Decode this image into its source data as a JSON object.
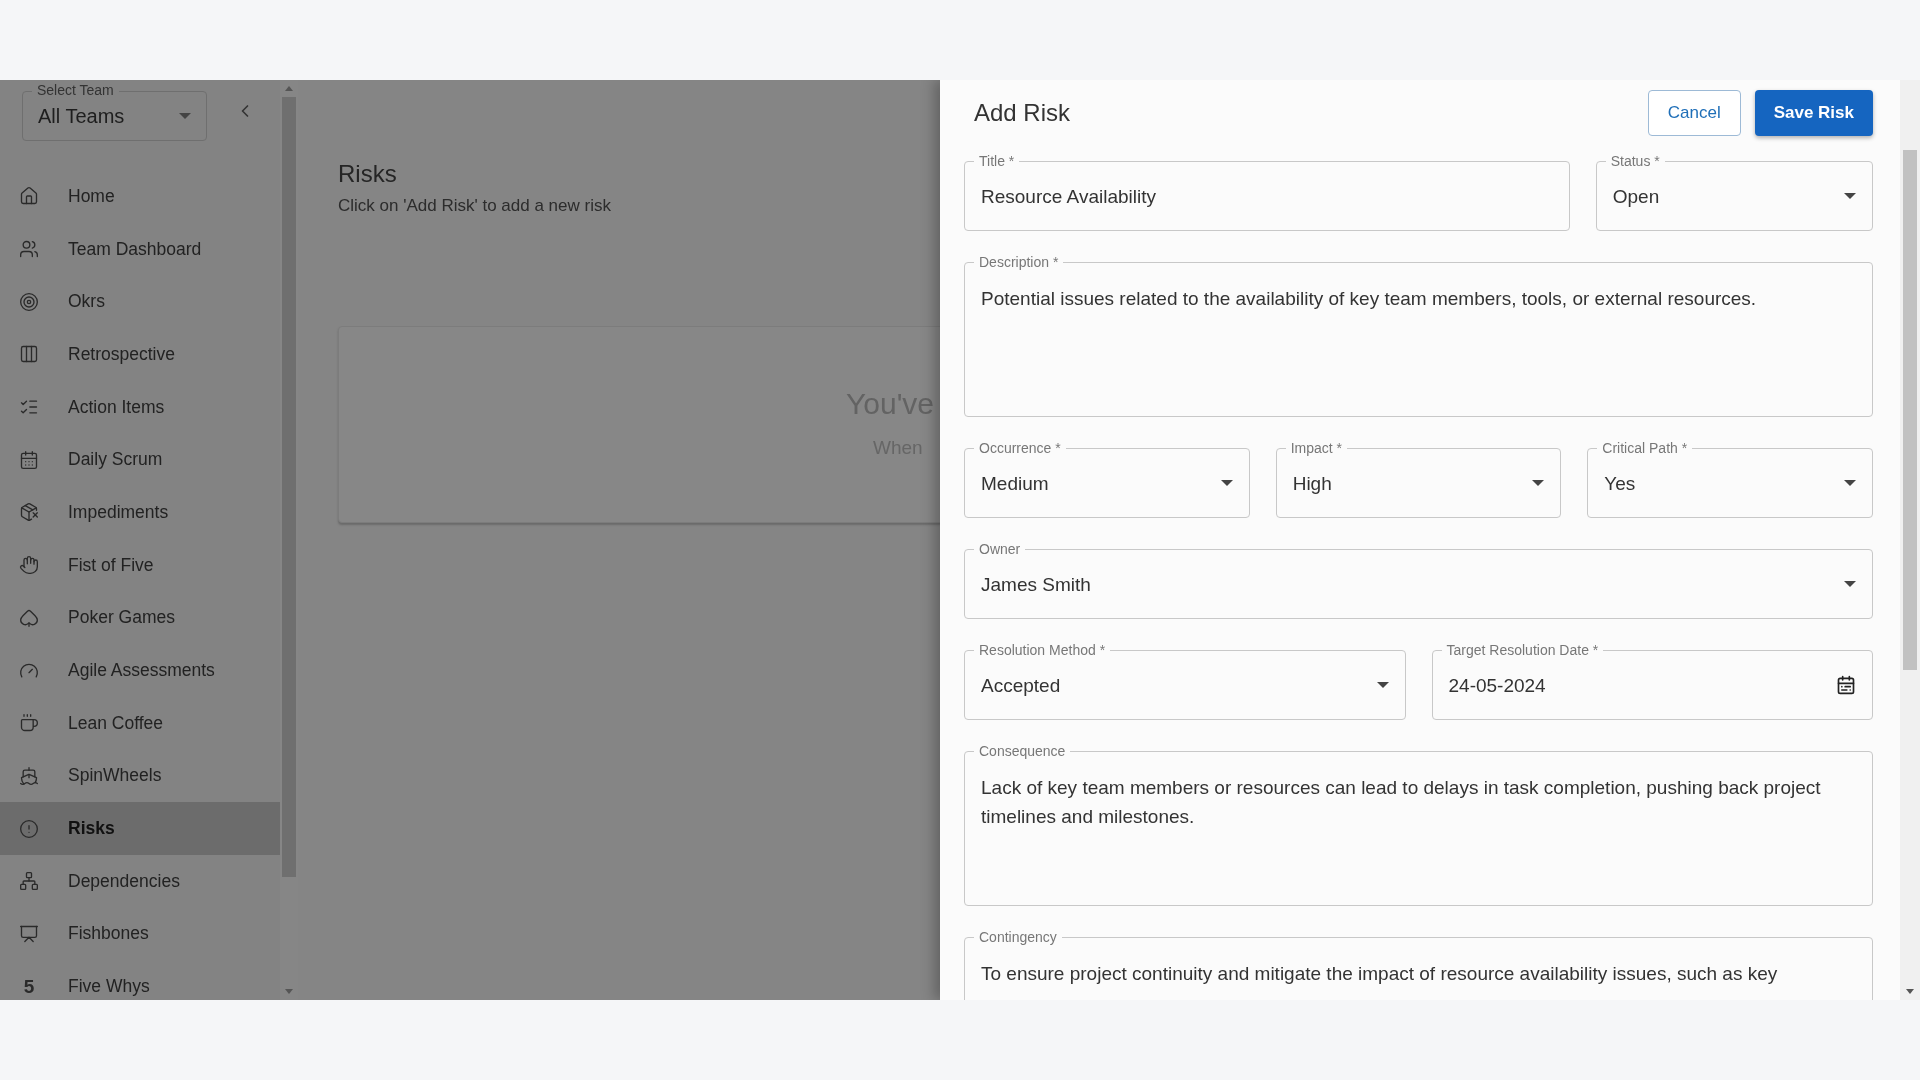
{
  "sidebar": {
    "team_select": {
      "label": "Select Team",
      "value": "All Teams"
    },
    "items": [
      {
        "label": "Home",
        "selected": false
      },
      {
        "label": "Team Dashboard",
        "selected": false
      },
      {
        "label": "Okrs",
        "selected": false
      },
      {
        "label": "Retrospective",
        "selected": false
      },
      {
        "label": "Action Items",
        "selected": false
      },
      {
        "label": "Daily Scrum",
        "selected": false
      },
      {
        "label": "Impediments",
        "selected": false
      },
      {
        "label": "Fist of Five",
        "selected": false
      },
      {
        "label": "Poker Games",
        "selected": false
      },
      {
        "label": "Agile Assessments",
        "selected": false
      },
      {
        "label": "Lean Coffee",
        "selected": false
      },
      {
        "label": "SpinWheels",
        "selected": false
      },
      {
        "label": "Risks",
        "selected": true
      },
      {
        "label": "Dependencies",
        "selected": false
      },
      {
        "label": "Fishbones",
        "selected": false
      },
      {
        "label": "Five Whys",
        "selected": false,
        "icon_text": "5"
      }
    ]
  },
  "page": {
    "title": "Risks",
    "subtitle": "Click on 'Add Risk' to add a new risk",
    "empty_state": {
      "heading": "You've",
      "text": "When"
    }
  },
  "drawer": {
    "title": "Add Risk",
    "buttons": [
      {
        "label": "Cancel",
        "kind": "outlined"
      },
      {
        "label": "Save Risk",
        "kind": "contained"
      }
    ],
    "form": {
      "title": {
        "label": "Title *",
        "value": "Resource Availability"
      },
      "status": {
        "label": "Status *",
        "value": "Open"
      },
      "description": {
        "label": "Description *",
        "value": "Potential issues related to the availability of key team members, tools, or external resources."
      },
      "occurrence": {
        "label": "Occurrence *",
        "value": "Medium"
      },
      "impact": {
        "label": "Impact *",
        "value": "High"
      },
      "critical_path": {
        "label": "Critical Path *",
        "value": "Yes"
      },
      "owner": {
        "label": "Owner",
        "value": "James Smith"
      },
      "resolution_method": {
        "label": "Resolution Method *",
        "value": "Accepted"
      },
      "target_resolution_date": {
        "label": "Target Resolution Date *",
        "value": "24-05-2024"
      },
      "consequence": {
        "label": "Consequence",
        "value": "Lack of key team members or resources can lead to delays in task completion, pushing back project timelines and milestones."
      },
      "contingency": {
        "label": "Contingency",
        "value": "To ensure project continuity and mitigate the impact of resource availability issues, such as key"
      }
    }
  }
}
